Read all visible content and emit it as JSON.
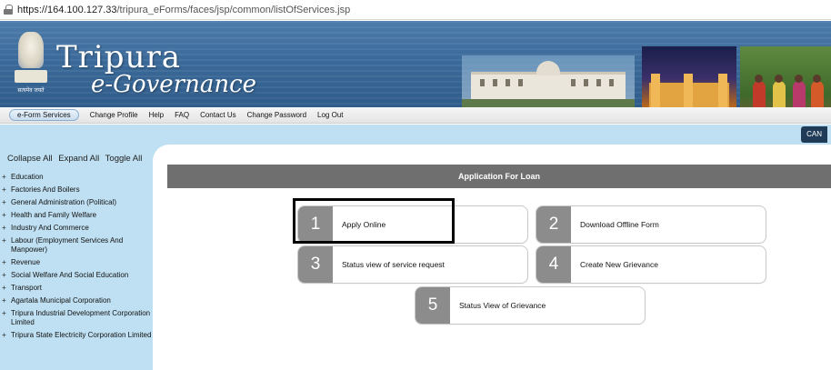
{
  "browser": {
    "url_host": "https://164.100.127.33",
    "url_path": "/tripura_eForms/faces/jsp/common/listOfServices.jsp"
  },
  "banner": {
    "title": "Tripura",
    "subtitle": "e-Governance",
    "motto": "सत्यमेव जयते"
  },
  "nav": {
    "items": [
      {
        "label": "e-Form Services",
        "active": true
      },
      {
        "label": "Change Profile",
        "active": false
      },
      {
        "label": "Help",
        "active": false
      },
      {
        "label": "FAQ",
        "active": false
      },
      {
        "label": "Contact Us",
        "active": false
      },
      {
        "label": "Change Password",
        "active": false
      },
      {
        "label": "Log Out",
        "active": false
      }
    ],
    "can_label": "CAN"
  },
  "sidebar": {
    "collapse_all": "Collapse All",
    "expand_all": "Expand All",
    "toggle_all": "Toggle All",
    "expander": "+",
    "items": [
      {
        "label": "Education"
      },
      {
        "label": "Factories And Boilers"
      },
      {
        "label": "General Administration (Political)"
      },
      {
        "label": "Health and Family Welfare"
      },
      {
        "label": "Industry And Commerce"
      },
      {
        "label": "Labour (Employment Services And Manpower)"
      },
      {
        "label": "Revenue"
      },
      {
        "label": "Social Welfare And Social Education"
      },
      {
        "label": "Transport"
      },
      {
        "label": "Agartala Municipal Corporation"
      },
      {
        "label": "Tripura Industrial Development Corporation Limited"
      },
      {
        "label": "Tripura State Electricity Corporation Limited"
      }
    ]
  },
  "main": {
    "header": "Application For Loan",
    "cards": [
      {
        "num": "1",
        "label": "Apply Online"
      },
      {
        "num": "2",
        "label": "Download Offline Form"
      },
      {
        "num": "3",
        "label": "Status view of service request"
      },
      {
        "num": "4",
        "label": "Create New Grievance"
      },
      {
        "num": "5",
        "label": "Status View of Grievance"
      }
    ]
  },
  "colors": {
    "banner_blue": "#3b6a9a",
    "sidebar_bg": "#bfe0f2",
    "header_gray": "#6f6f6f",
    "card_number_bg": "#8c8c8c"
  }
}
